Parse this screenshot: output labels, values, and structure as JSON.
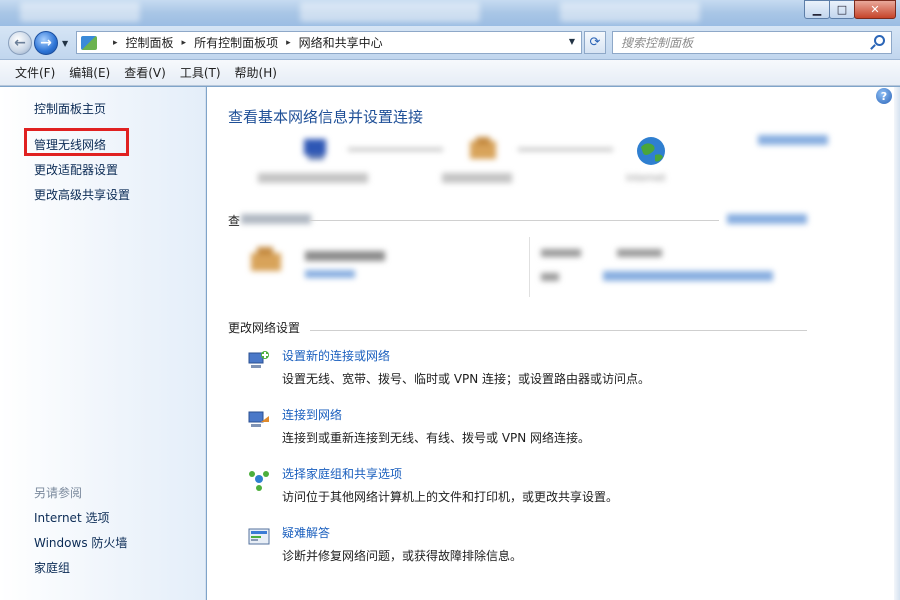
{
  "window": {
    "minimize_glyph": "▁",
    "maximize_glyph": "□",
    "close_glyph": "✕"
  },
  "navigation": {
    "back_glyph": "←",
    "forward_glyph": "→",
    "dropdown_glyph": "▼",
    "refresh_glyph": "⟳",
    "breadcrumb": [
      "控制面板",
      "所有控制面板项",
      "网络和共享中心"
    ],
    "separator": "▸"
  },
  "search": {
    "placeholder": "搜索控制面板"
  },
  "menu": [
    "文件(F)",
    "编辑(E)",
    "查看(V)",
    "工具(T)",
    "帮助(H)"
  ],
  "sidebar": {
    "home": "控制面板主页",
    "links": [
      "管理无线网络",
      "更改适配器设置",
      "更改高级共享设置"
    ],
    "see_also_title": "另请参阅",
    "see_also": [
      "Internet 选项",
      "Windows 防火墙",
      "家庭组"
    ]
  },
  "main": {
    "help_glyph": "?",
    "title": "查看基本网络信息并设置连接",
    "map": {
      "internet_label": "Internet"
    },
    "active_header": "查",
    "change_settings_header": "更改网络设置",
    "tasks": [
      {
        "title": "设置新的连接或网络",
        "desc": "设置无线、宽带、拨号、临时或 VPN 连接；或设置路由器或访问点。",
        "icon": "network-setup-icon"
      },
      {
        "title": "连接到网络",
        "desc": "连接到或重新连接到无线、有线、拨号或 VPN 网络连接。",
        "icon": "connect-network-icon"
      },
      {
        "title": "选择家庭组和共享选项",
        "desc": "访问位于其他网络计算机上的文件和打印机，或更改共享设置。",
        "icon": "homegroup-icon"
      },
      {
        "title": "疑难解答",
        "desc": "诊断并修复网络问题，或获得故障排除信息。",
        "icon": "troubleshoot-icon"
      }
    ]
  },
  "colors": {
    "accent": "#1a5fbe",
    "title_blue": "#1e4f97",
    "highlight": "#e02121"
  }
}
